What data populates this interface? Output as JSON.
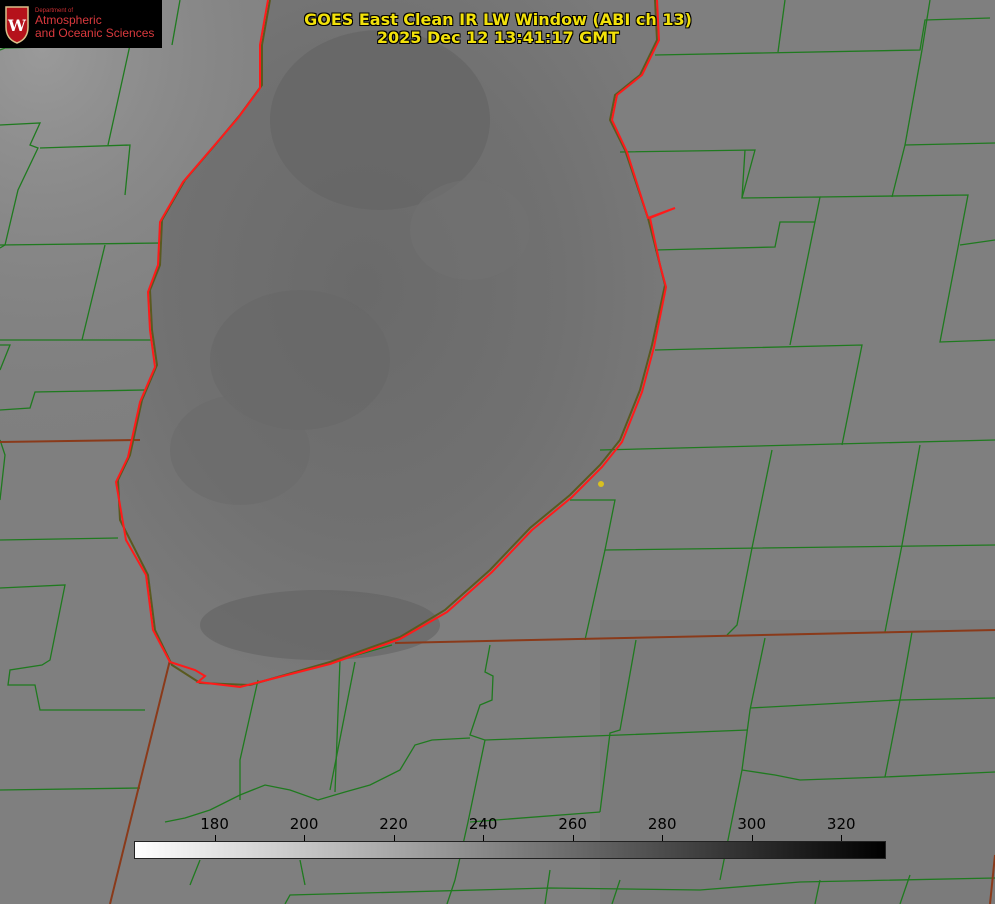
{
  "title": {
    "line1": "GOES East Clean IR LW Window (ABI ch 13)",
    "line2": "2025 Dec 12 13:41:17 GMT"
  },
  "logo": {
    "small_text": "Department of",
    "line1": "Atmospheric",
    "line2": "and Oceanic Sciences",
    "shield_letter": "W"
  },
  "colorbar": {
    "ticks": [
      "180",
      "200",
      "220",
      "240",
      "260",
      "280",
      "300",
      "320"
    ],
    "range": [
      162,
      330
    ],
    "colormap": "white-to-black grayscale",
    "units": ""
  },
  "colors": {
    "county_lines": "#1f7a1f",
    "state_lines": "#8a3a1a",
    "lake_shoreline": "#ff1a1a",
    "title_text": "#f2e10a",
    "marker": "#d8c020",
    "background": "#7e7e7e"
  },
  "features": {
    "lake": "lake-michigan",
    "marker": "location-dot"
  }
}
